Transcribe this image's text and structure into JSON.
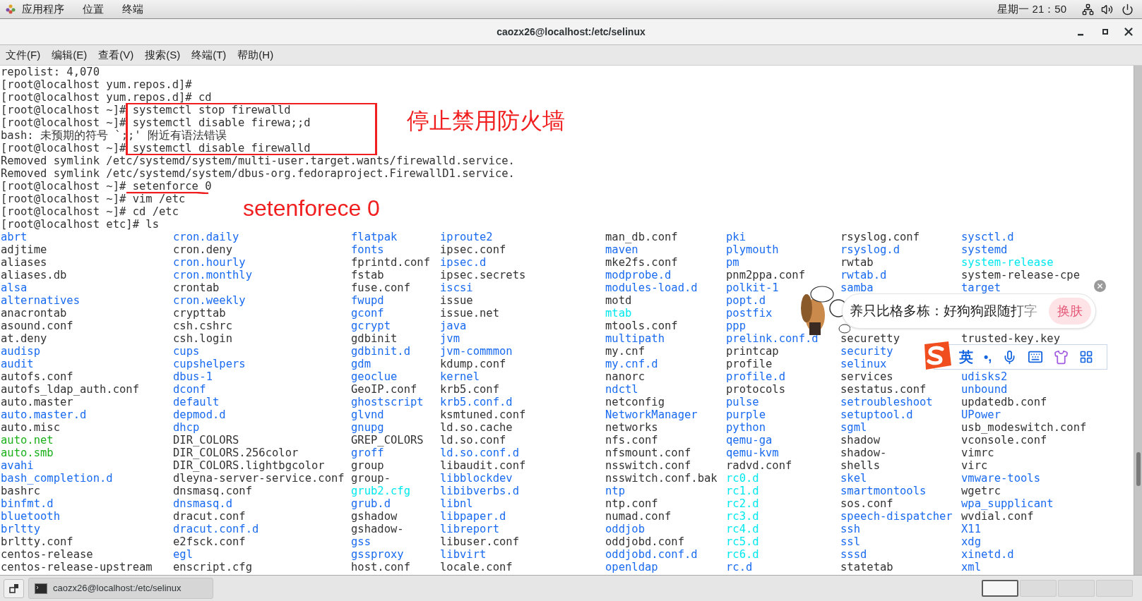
{
  "top_bar": {
    "menus": [
      "应用程序",
      "位置",
      "终端"
    ],
    "clock": "星期一 21：50"
  },
  "window": {
    "title": "caozx26@localhost:/etc/selinux"
  },
  "menu_bar": [
    "文件(F)",
    "编辑(E)",
    "查看(V)",
    "搜索(S)",
    "终端(T)",
    "帮助(H)"
  ],
  "terminal": {
    "lines": [
      "repolist: 4,070",
      "[root@localhost yum.repos.d]#",
      "[root@localhost yum.repos.d]# cd",
      "[root@localhost ~]# systemctl stop firewalld",
      "[root@localhost ~]# systemctl disable firewa;;d",
      "bash: 未预期的符号 `;;' 附近有语法错误",
      "[root@localhost ~]# systemctl disable firewalld",
      "Removed symlink /etc/systemd/system/multi-user.target.wants/firewalld.service.",
      "Removed symlink /etc/systemd/system/dbus-org.fedoraproject.FirewallD1.service.",
      "[root@localhost ~]# setenforce 0",
      "[root@localhost ~]# vim /etc",
      "[root@localhost ~]# cd /etc",
      "[root@localhost etc]# ls"
    ],
    "listing": [
      [
        {
          "name": "abrt",
          "kind": "dir"
        },
        {
          "name": "adjtime",
          "kind": "file"
        },
        {
          "name": "aliases",
          "kind": "file"
        },
        {
          "name": "aliases.db",
          "kind": "file"
        },
        {
          "name": "alsa",
          "kind": "dir"
        },
        {
          "name": "alternatives",
          "kind": "dir"
        },
        {
          "name": "anacrontab",
          "kind": "file"
        },
        {
          "name": "asound.conf",
          "kind": "file"
        },
        {
          "name": "at.deny",
          "kind": "file"
        },
        {
          "name": "audisp",
          "kind": "dir"
        },
        {
          "name": "audit",
          "kind": "dir"
        },
        {
          "name": "autofs.conf",
          "kind": "file"
        },
        {
          "name": "autofs_ldap_auth.conf",
          "kind": "file"
        },
        {
          "name": "auto.master",
          "kind": "file"
        },
        {
          "name": "auto.master.d",
          "kind": "dir"
        },
        {
          "name": "auto.misc",
          "kind": "file"
        },
        {
          "name": "auto.net",
          "kind": "exec"
        },
        {
          "name": "auto.smb",
          "kind": "exec"
        },
        {
          "name": "avahi",
          "kind": "dir"
        },
        {
          "name": "bash_completion.d",
          "kind": "dir"
        },
        {
          "name": "bashrc",
          "kind": "file"
        },
        {
          "name": "binfmt.d",
          "kind": "dir"
        },
        {
          "name": "bluetooth",
          "kind": "dir"
        },
        {
          "name": "brltty",
          "kind": "dir"
        },
        {
          "name": "brltty.conf",
          "kind": "file"
        },
        {
          "name": "centos-release",
          "kind": "file"
        },
        {
          "name": "centos-release-upstream",
          "kind": "file"
        }
      ],
      [
        {
          "name": "cron.daily",
          "kind": "dir"
        },
        {
          "name": "cron.deny",
          "kind": "file"
        },
        {
          "name": "cron.hourly",
          "kind": "dir"
        },
        {
          "name": "cron.monthly",
          "kind": "dir"
        },
        {
          "name": "crontab",
          "kind": "file"
        },
        {
          "name": "cron.weekly",
          "kind": "dir"
        },
        {
          "name": "crypttab",
          "kind": "file"
        },
        {
          "name": "csh.cshrc",
          "kind": "file"
        },
        {
          "name": "csh.login",
          "kind": "file"
        },
        {
          "name": "cups",
          "kind": "dir"
        },
        {
          "name": "cupshelpers",
          "kind": "dir"
        },
        {
          "name": "dbus-1",
          "kind": "dir"
        },
        {
          "name": "dconf",
          "kind": "dir"
        },
        {
          "name": "default",
          "kind": "dir"
        },
        {
          "name": "depmod.d",
          "kind": "dir"
        },
        {
          "name": "dhcp",
          "kind": "dir"
        },
        {
          "name": "DIR_COLORS",
          "kind": "file"
        },
        {
          "name": "DIR_COLORS.256color",
          "kind": "file"
        },
        {
          "name": "DIR_COLORS.lightbgcolor",
          "kind": "file"
        },
        {
          "name": "dleyna-server-service.conf",
          "kind": "file"
        },
        {
          "name": "dnsmasq.conf",
          "kind": "file"
        },
        {
          "name": "dnsmasq.d",
          "kind": "dir"
        },
        {
          "name": "dracut.conf",
          "kind": "file"
        },
        {
          "name": "dracut.conf.d",
          "kind": "dir"
        },
        {
          "name": "e2fsck.conf",
          "kind": "file"
        },
        {
          "name": "egl",
          "kind": "dir"
        },
        {
          "name": "enscript.cfg",
          "kind": "file"
        }
      ],
      [
        {
          "name": "flatpak",
          "kind": "dir"
        },
        {
          "name": "fonts",
          "kind": "dir"
        },
        {
          "name": "fprintd.conf",
          "kind": "file"
        },
        {
          "name": "fstab",
          "kind": "file"
        },
        {
          "name": "fuse.conf",
          "kind": "file"
        },
        {
          "name": "fwupd",
          "kind": "dir"
        },
        {
          "name": "gconf",
          "kind": "dir"
        },
        {
          "name": "gcrypt",
          "kind": "dir"
        },
        {
          "name": "gdbinit",
          "kind": "file"
        },
        {
          "name": "gdbinit.d",
          "kind": "dir"
        },
        {
          "name": "gdm",
          "kind": "dir"
        },
        {
          "name": "geoclue",
          "kind": "dir"
        },
        {
          "name": "GeoIP.conf",
          "kind": "file"
        },
        {
          "name": "ghostscript",
          "kind": "dir"
        },
        {
          "name": "glvnd",
          "kind": "dir"
        },
        {
          "name": "gnupg",
          "kind": "dir"
        },
        {
          "name": "GREP_COLORS",
          "kind": "file"
        },
        {
          "name": "groff",
          "kind": "dir"
        },
        {
          "name": "group",
          "kind": "file"
        },
        {
          "name": "group-",
          "kind": "file"
        },
        {
          "name": "grub2.cfg",
          "kind": "link"
        },
        {
          "name": "grub.d",
          "kind": "dir"
        },
        {
          "name": "gshadow",
          "kind": "file"
        },
        {
          "name": "gshadow-",
          "kind": "file"
        },
        {
          "name": "gss",
          "kind": "dir"
        },
        {
          "name": "gssproxy",
          "kind": "dir"
        },
        {
          "name": "host.conf",
          "kind": "file"
        }
      ],
      [
        {
          "name": "iproute2",
          "kind": "dir"
        },
        {
          "name": "ipsec.conf",
          "kind": "file"
        },
        {
          "name": "ipsec.d",
          "kind": "dir"
        },
        {
          "name": "ipsec.secrets",
          "kind": "file"
        },
        {
          "name": "iscsi",
          "kind": "dir"
        },
        {
          "name": "issue",
          "kind": "file"
        },
        {
          "name": "issue.net",
          "kind": "file"
        },
        {
          "name": "java",
          "kind": "dir"
        },
        {
          "name": "jvm",
          "kind": "dir"
        },
        {
          "name": "jvm-commmon",
          "kind": "dir"
        },
        {
          "name": "kdump.conf",
          "kind": "file"
        },
        {
          "name": "kernel",
          "kind": "dir"
        },
        {
          "name": "krb5.conf",
          "kind": "file"
        },
        {
          "name": "krb5.conf.d",
          "kind": "dir"
        },
        {
          "name": "ksmtuned.conf",
          "kind": "file"
        },
        {
          "name": "ld.so.cache",
          "kind": "file"
        },
        {
          "name": "ld.so.conf",
          "kind": "file"
        },
        {
          "name": "ld.so.conf.d",
          "kind": "dir"
        },
        {
          "name": "libaudit.conf",
          "kind": "file"
        },
        {
          "name": "libblockdev",
          "kind": "dir"
        },
        {
          "name": "libibverbs.d",
          "kind": "dir"
        },
        {
          "name": "libnl",
          "kind": "dir"
        },
        {
          "name": "libpaper.d",
          "kind": "dir"
        },
        {
          "name": "libreport",
          "kind": "dir"
        },
        {
          "name": "libuser.conf",
          "kind": "file"
        },
        {
          "name": "libvirt",
          "kind": "dir"
        },
        {
          "name": "locale.conf",
          "kind": "file"
        }
      ],
      [
        {
          "name": "man_db.conf",
          "kind": "file"
        },
        {
          "name": "maven",
          "kind": "dir"
        },
        {
          "name": "mke2fs.conf",
          "kind": "file"
        },
        {
          "name": "modprobe.d",
          "kind": "dir"
        },
        {
          "name": "modules-load.d",
          "kind": "dir"
        },
        {
          "name": "motd",
          "kind": "file"
        },
        {
          "name": "mtab",
          "kind": "link"
        },
        {
          "name": "mtools.conf",
          "kind": "file"
        },
        {
          "name": "multipath",
          "kind": "dir"
        },
        {
          "name": "my.cnf",
          "kind": "file"
        },
        {
          "name": "my.cnf.d",
          "kind": "dir"
        },
        {
          "name": "nanorc",
          "kind": "file"
        },
        {
          "name": "ndctl",
          "kind": "dir"
        },
        {
          "name": "netconfig",
          "kind": "file"
        },
        {
          "name": "NetworkManager",
          "kind": "dir"
        },
        {
          "name": "networks",
          "kind": "file"
        },
        {
          "name": "nfs.conf",
          "kind": "file"
        },
        {
          "name": "nfsmount.conf",
          "kind": "file"
        },
        {
          "name": "nsswitch.conf",
          "kind": "file"
        },
        {
          "name": "nsswitch.conf.bak",
          "kind": "file"
        },
        {
          "name": "ntp",
          "kind": "dir"
        },
        {
          "name": "ntp.conf",
          "kind": "file"
        },
        {
          "name": "numad.conf",
          "kind": "file"
        },
        {
          "name": "oddjob",
          "kind": "dir"
        },
        {
          "name": "oddjobd.conf",
          "kind": "file"
        },
        {
          "name": "oddjobd.conf.d",
          "kind": "dir"
        },
        {
          "name": "openldap",
          "kind": "dir"
        }
      ],
      [
        {
          "name": "pki",
          "kind": "dir"
        },
        {
          "name": "plymouth",
          "kind": "dir"
        },
        {
          "name": "pm",
          "kind": "dir"
        },
        {
          "name": "pnm2ppa.conf",
          "kind": "file"
        },
        {
          "name": "polkit-1",
          "kind": "dir"
        },
        {
          "name": "popt.d",
          "kind": "dir"
        },
        {
          "name": "postfix",
          "kind": "dir"
        },
        {
          "name": "ppp",
          "kind": "dir"
        },
        {
          "name": "prelink.conf.d",
          "kind": "dir"
        },
        {
          "name": "printcap",
          "kind": "file"
        },
        {
          "name": "profile",
          "kind": "file"
        },
        {
          "name": "profile.d",
          "kind": "dir"
        },
        {
          "name": "protocols",
          "kind": "file"
        },
        {
          "name": "pulse",
          "kind": "dir"
        },
        {
          "name": "purple",
          "kind": "dir"
        },
        {
          "name": "python",
          "kind": "dir"
        },
        {
          "name": "qemu-ga",
          "kind": "dir"
        },
        {
          "name": "qemu-kvm",
          "kind": "dir"
        },
        {
          "name": "radvd.conf",
          "kind": "file"
        },
        {
          "name": "rc0.d",
          "kind": "link"
        },
        {
          "name": "rc1.d",
          "kind": "link"
        },
        {
          "name": "rc2.d",
          "kind": "link"
        },
        {
          "name": "rc3.d",
          "kind": "link"
        },
        {
          "name": "rc4.d",
          "kind": "link"
        },
        {
          "name": "rc5.d",
          "kind": "link"
        },
        {
          "name": "rc6.d",
          "kind": "link"
        },
        {
          "name": "rc.d",
          "kind": "dir"
        }
      ],
      [
        {
          "name": "rsyslog.conf",
          "kind": "file"
        },
        {
          "name": "rsyslog.d",
          "kind": "dir"
        },
        {
          "name": "rwtab",
          "kind": "file"
        },
        {
          "name": "rwtab.d",
          "kind": "dir"
        },
        {
          "name": "samba",
          "kind": "dir"
        },
        {
          "kind": "covered"
        },
        {
          "kind": "covered"
        },
        {
          "kind": "covered"
        },
        {
          "name": "securetty",
          "kind": "file"
        },
        {
          "name": "security",
          "kind": "dir"
        },
        {
          "name": "selinux",
          "kind": "dir"
        },
        {
          "name": "services",
          "kind": "file"
        },
        {
          "name": "sestatus.conf",
          "kind": "file"
        },
        {
          "name": "setroubleshoot",
          "kind": "dir"
        },
        {
          "name": "setuptool.d",
          "kind": "dir"
        },
        {
          "name": "sgml",
          "kind": "dir"
        },
        {
          "name": "shadow",
          "kind": "file"
        },
        {
          "name": "shadow-",
          "kind": "file"
        },
        {
          "name": "shells",
          "kind": "file"
        },
        {
          "name": "skel",
          "kind": "dir"
        },
        {
          "name": "smartmontools",
          "kind": "dir"
        },
        {
          "name": "sos.conf",
          "kind": "file"
        },
        {
          "name": "speech-dispatcher",
          "kind": "dir"
        },
        {
          "name": "ssh",
          "kind": "dir"
        },
        {
          "name": "ssl",
          "kind": "dir"
        },
        {
          "name": "sssd",
          "kind": "dir"
        },
        {
          "name": "statetab",
          "kind": "file"
        }
      ],
      [
        {
          "name": "sysctl.d",
          "kind": "dir"
        },
        {
          "name": "systemd",
          "kind": "dir"
        },
        {
          "name": "system-release",
          "kind": "link"
        },
        {
          "name": "system-release-cpe",
          "kind": "file"
        },
        {
          "name": "target",
          "kind": "dir"
        },
        {
          "kind": "covered"
        },
        {
          "kind": "covered"
        },
        {
          "kind": "covered"
        },
        {
          "name": "trusted-key.key",
          "kind": "file"
        },
        {
          "kind": "covered"
        },
        {
          "kind": "covered"
        },
        {
          "name": "udisks2",
          "kind": "dir"
        },
        {
          "name": "unbound",
          "kind": "dir"
        },
        {
          "name": "updatedb.conf",
          "kind": "file"
        },
        {
          "name": "UPower",
          "kind": "dir"
        },
        {
          "name": "usb_modeswitch.conf",
          "kind": "file"
        },
        {
          "name": "vconsole.conf",
          "kind": "file"
        },
        {
          "name": "vimrc",
          "kind": "file"
        },
        {
          "name": "virc",
          "kind": "file"
        },
        {
          "name": "vmware-tools",
          "kind": "dir"
        },
        {
          "name": "wgetrc",
          "kind": "file"
        },
        {
          "name": "wpa_supplicant",
          "kind": "dir"
        },
        {
          "name": "wvdial.conf",
          "kind": "file"
        },
        {
          "name": "X11",
          "kind": "dir"
        },
        {
          "name": "xdg",
          "kind": "dir"
        },
        {
          "name": "xinetd.d",
          "kind": "dir"
        },
        {
          "name": "xml",
          "kind": "dir"
        }
      ]
    ]
  },
  "annotations": {
    "box_note": "停止禁用防火墙",
    "underline_note": "setenforece 0"
  },
  "ime": {
    "tip": "养只比格多栋：好狗狗跟随打字",
    "skin_button": "换肤",
    "mode": "英",
    "punct": "•,"
  },
  "taskbar": {
    "task": "caozx26@localhost:/etc/selinux",
    "workspaces": [
      {
        "selected": true
      },
      {
        "selected": false
      },
      {
        "selected": false
      },
      {
        "selected": false
      }
    ]
  }
}
